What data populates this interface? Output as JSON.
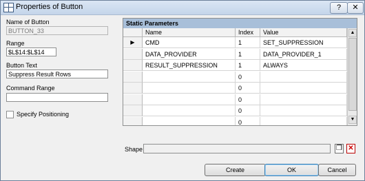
{
  "window": {
    "title": "Properties of Button",
    "help_button": "?",
    "close_button": "✕"
  },
  "left": {
    "name_label": "Name of Button",
    "name_value": "BUTTON_33",
    "range_label": "Range",
    "range_value": "$L$14:$L$14",
    "button_text_label": "Button Text",
    "button_text_value": "Suppress Result Rows",
    "command_range_label": "Command Range",
    "command_range_value": "",
    "specify_positioning_label": "Specify Positioning",
    "specify_positioning_checked": false
  },
  "table": {
    "title": "Static Parameters",
    "columns": [
      "Name",
      "Index",
      "Value"
    ],
    "selected_row": 0,
    "rows": [
      {
        "name": "CMD",
        "index": "1",
        "value": "SET_SUPPRESSION"
      },
      {
        "name": "DATA_PROVIDER",
        "index": "1",
        "value": "DATA_PROVIDER_1"
      },
      {
        "name": "RESULT_SUPPRESSION",
        "index": "1",
        "value": "ALWAYS"
      },
      {
        "name": "",
        "index": "0",
        "value": ""
      },
      {
        "name": "",
        "index": "0",
        "value": ""
      },
      {
        "name": "",
        "index": "0",
        "value": ""
      },
      {
        "name": "",
        "index": "0",
        "value": ""
      },
      {
        "name": "",
        "index": "0",
        "value": ""
      }
    ]
  },
  "shape": {
    "label": "Shape",
    "value": ""
  },
  "buttons": {
    "create": "Create",
    "ok": "OK",
    "cancel": "Cancel"
  }
}
